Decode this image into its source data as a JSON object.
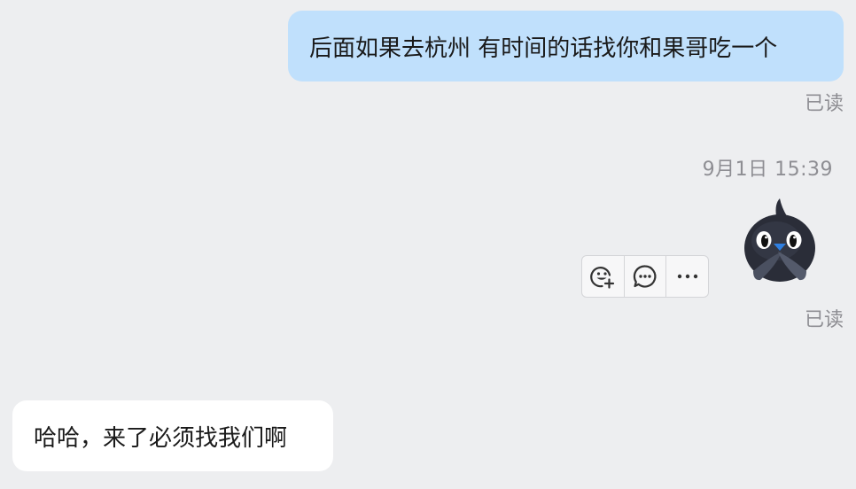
{
  "messages": [
    {
      "direction": "outgoing",
      "text": "后面如果去杭州 有时间的话找你和果哥吃一个",
      "status": "已读"
    },
    {
      "direction": "outgoing",
      "type": "sticker",
      "sticker_icon": "bird-sticker",
      "status": "已读"
    },
    {
      "direction": "incoming",
      "text": "哈哈，来了必须找我们啊"
    }
  ],
  "timestamp": "9月1日 15:39",
  "message_toolbar": {
    "actions": [
      {
        "icon": "emoji-add-icon"
      },
      {
        "icon": "reply-bubble-icon"
      },
      {
        "icon": "more-icon"
      }
    ]
  },
  "colors": {
    "background": "#edeef0",
    "outgoing_bubble": "#c0e0fc",
    "incoming_bubble": "#ffffff",
    "meta_text": "#8e8e93"
  }
}
